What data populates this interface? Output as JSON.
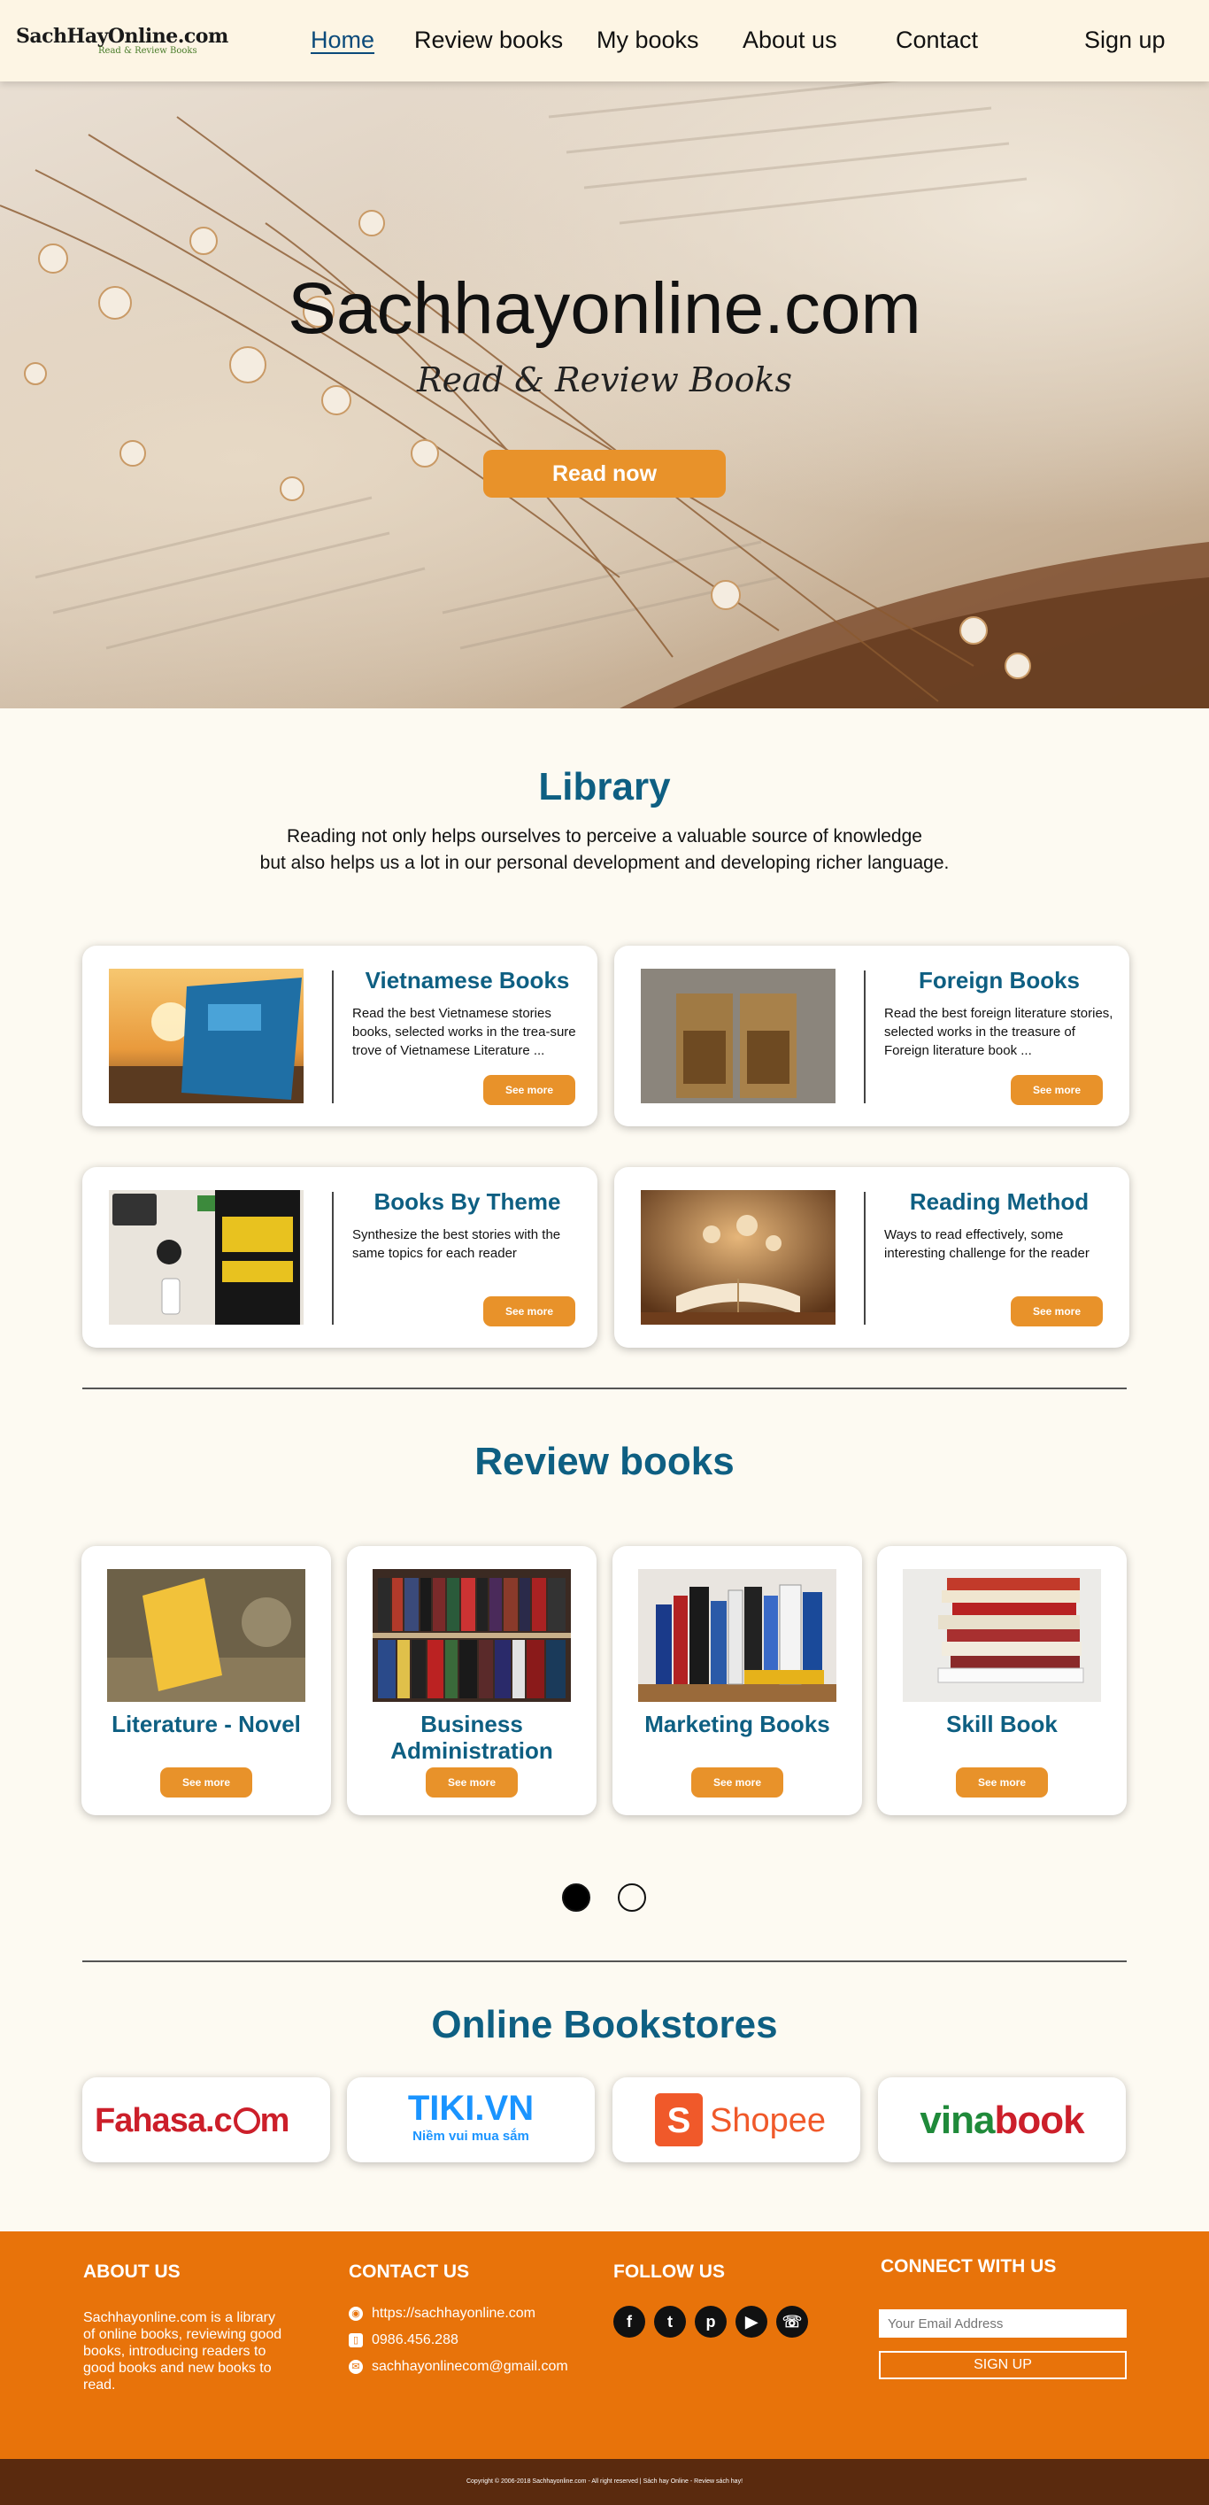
{
  "nav": {
    "logo_main": "SachHayOnline.com",
    "logo_sub": "Read & Review Books",
    "links": [
      "Home",
      "Review books",
      "My books",
      "About us",
      "Contact"
    ],
    "signup": "Sign up"
  },
  "hero": {
    "title": "Sachhayonline.com",
    "subtitle": "Read & Review Books",
    "button": "Read now"
  },
  "library": {
    "title": "Library",
    "intro_line1": "Reading not only helps ourselves to perceive a valuable source of knowledge",
    "intro_line2": "but also helps us a lot in our personal development and developing richer language.",
    "cards": [
      {
        "title": "Vietnamese Books",
        "desc": "Read the best Vietnamese stories books, selected works in the trea-sure trove of Vietnamese Literature ...",
        "button": "See more"
      },
      {
        "title": "Foreign Books",
        "desc": "Read the best foreign literature stories, selected works in the treasure of Foreign literature book ...",
        "button": "See more"
      },
      {
        "title": "Books By Theme",
        "desc": "Synthesize the best stories with the same topics for each reader",
        "button": "See more"
      },
      {
        "title": "Reading Method",
        "desc": "Ways to read effectively, some interesting challenge for the reader",
        "button": "See more"
      }
    ]
  },
  "review": {
    "title": "Review books",
    "cards": [
      {
        "title": "Literature - Novel",
        "button": "See more"
      },
      {
        "title": "Business Administration",
        "button": "See more"
      },
      {
        "title": "Marketing Books",
        "button": "See more"
      },
      {
        "title": "Skill Book",
        "button": "See more"
      }
    ],
    "active_dot": 0
  },
  "stores": {
    "title": "Online Bookstores",
    "fahasa": "Fahasa.c",
    "tiki": "TIKI.VN",
    "tiki_tag": "Niềm vui mua sắm",
    "shopee": "Shopee",
    "vina": "vina",
    "vina_book": "book"
  },
  "footer": {
    "about_head": "ABOUT US",
    "about_text": "Sachhayonline.com is a library of online books, reviewing good books, introducing readers to good books and new books to read.",
    "contact_head": "CONTACT US",
    "website": "https://sachhayonline.com",
    "phone": "0986.456.288",
    "email": "sachhayonlinecom@gmail.com",
    "follow_head": "FOLLOW US",
    "connect_head": "CONNECT WITH US",
    "email_placeholder": "Your Email Address",
    "signup_button": "SIGN UP",
    "copyright": "Copyright © 2006-2018 Sachhayonline.com - All right reserved | Sách hay Online - Review sách hay!"
  },
  "colors": {
    "accent": "#e8922a",
    "heading": "#0e5f82",
    "footer": "#e8730a",
    "footer_bottom": "#5a2a0e"
  }
}
